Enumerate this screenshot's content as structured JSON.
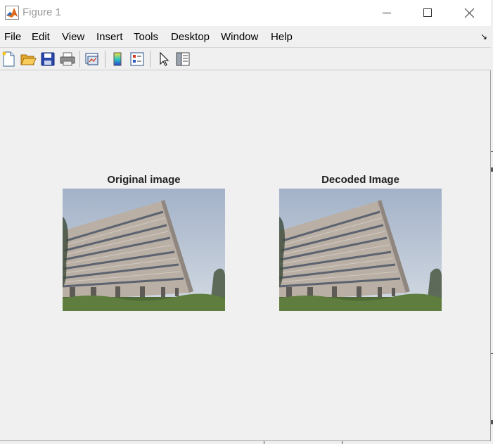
{
  "window": {
    "title": "Figure 1"
  },
  "menu": {
    "items": [
      "File",
      "Edit",
      "View",
      "Insert",
      "Tools",
      "Desktop",
      "Window",
      "Help"
    ]
  },
  "toolbar": {
    "buttons": [
      {
        "name": "new-figure",
        "icon": "new-file-icon"
      },
      {
        "name": "open-file",
        "icon": "open-folder-icon"
      },
      {
        "name": "save-figure",
        "icon": "save-icon"
      },
      {
        "name": "print-figure",
        "icon": "print-icon"
      },
      {
        "name": "link-plot",
        "icon": "link-plot-icon"
      },
      {
        "name": "insert-colorbar",
        "icon": "colorbar-icon"
      },
      {
        "name": "insert-legend",
        "icon": "legend-icon"
      },
      {
        "name": "edit-plot",
        "icon": "pointer-icon"
      },
      {
        "name": "property-inspector",
        "icon": "property-inspector-icon"
      }
    ]
  },
  "axes": [
    {
      "title": "Original image"
    },
    {
      "title": "Decoded Image"
    }
  ],
  "colors": {
    "figure_bg": "#f0f0f0",
    "matlab_orange": "#e16b1a",
    "sky": "#b8c4d6",
    "facade": "#b7ada3",
    "grass": "#4f6b35"
  }
}
